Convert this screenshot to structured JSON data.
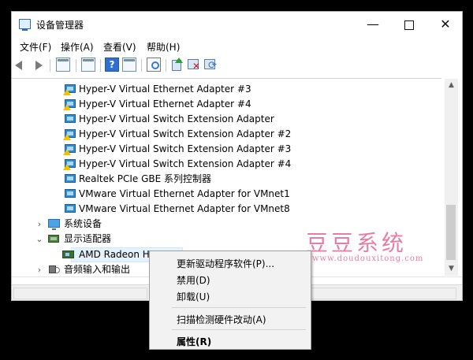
{
  "window": {
    "title": "设备管理器",
    "controls": {
      "minimize": "—",
      "close": "✕"
    }
  },
  "menubar": {
    "items": [
      "文件(F)",
      "操作(A)",
      "查看(V)",
      "帮助(H)"
    ]
  },
  "toolbar": {
    "help_glyph": "?",
    "icons": [
      "back-arrow-icon",
      "forward-arrow-icon",
      "console-tree-icon",
      "properties-icon",
      "help-icon",
      "window-icon",
      "scan-hardware-icon",
      "update-driver-icon",
      "disable-device-icon",
      "uninstall-refresh-icon"
    ]
  },
  "tree": {
    "network_adapters": [
      "Hyper-V Virtual Ethernet Adapter #3",
      "Hyper-V Virtual Ethernet Adapter #4",
      "Hyper-V Virtual Switch Extension Adapter",
      "Hyper-V Virtual Switch Extension Adapter #2",
      "Hyper-V Virtual Switch Extension Adapter #3",
      "Hyper-V Virtual Switch Extension Adapter #4",
      "Realtek PCIe GBE 系列控制器",
      "VMware Virtual Ethernet Adapter for VMnet1",
      "VMware Virtual Ethernet Adapter for VMnet8"
    ],
    "system_devices": "系统设备",
    "display_adapters": "显示适配器",
    "selected_device": "AMD Radeon HD",
    "audio": "音频输入和输出",
    "expander_collapsed": "›",
    "expander_expanded": "⌄"
  },
  "context_menu": {
    "update_driver": "更新驱动程序软件(P)...",
    "disable": "禁用(D)",
    "uninstall": "卸载(U)",
    "scan": "扫描检测硬件改动(A)",
    "properties": "属性(R)"
  },
  "watermark": {
    "title": "豆豆系统",
    "url": "www.doudouxitong.com"
  },
  "scrollbar": {
    "up": "▲",
    "down": "▼"
  },
  "colors": {
    "background": "#000000",
    "window": "#ffffff",
    "selection": "#e5f1fb",
    "watermark": "#e67da6",
    "help_icon": "#2f6fd0"
  }
}
